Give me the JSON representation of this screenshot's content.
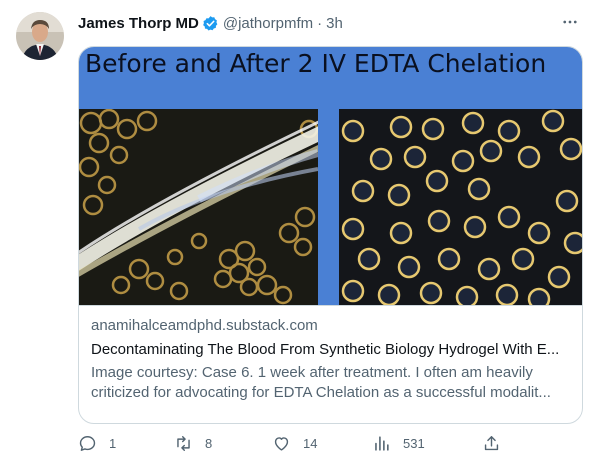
{
  "author": {
    "name": "James Thorp MD",
    "handle": "@jathorpmfm",
    "separator": "·",
    "time": "3h",
    "verified": true
  },
  "card": {
    "image_title": "Before and After 2 IV EDTA Chelation",
    "domain": "anamihalceamdphd.substack.com",
    "title": "Decontaminating The Blood From Synthetic Biology Hydrogel With E...",
    "description_line1": "Image courtesy: Case 6. 1 week after treatment. I often am heavily",
    "description_line2": "criticized for advocating for EDTA Chelation as a successful modalit..."
  },
  "actions": {
    "replies": "1",
    "retweets": "8",
    "likes": "14",
    "views": "531"
  },
  "colors": {
    "verified": "#1d9bf0",
    "card_bg": "#4a80d4",
    "muted": "#536471"
  },
  "icons": {
    "more": "more-dots-icon",
    "reply": "reply-icon",
    "retweet": "retweet-icon",
    "like": "heart-icon",
    "views": "views-bar-icon",
    "share": "share-icon"
  }
}
